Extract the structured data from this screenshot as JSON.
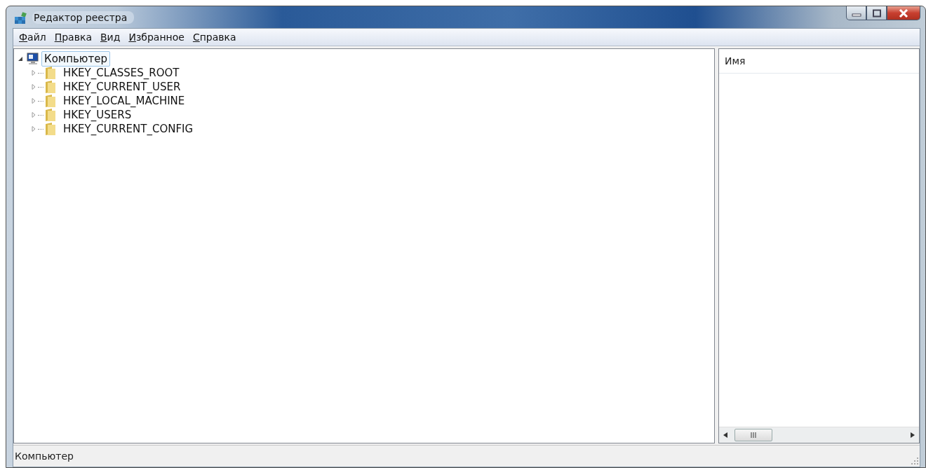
{
  "window": {
    "title": "Редактор реестра"
  },
  "menu": [
    "Файл",
    "Правка",
    "Вид",
    "Избранное",
    "Справка"
  ],
  "tree": {
    "label": "Компьютер",
    "expanded": true,
    "selected": true,
    "children": [
      {
        "label": "HKEY_CLASSES_ROOT",
        "expanded": false,
        "selected": false
      },
      {
        "label": "HKEY_CURRENT_USER",
        "expanded": false,
        "selected": false
      },
      {
        "label": "HKEY_LOCAL_MACHINE",
        "expanded": false,
        "selected": false
      },
      {
        "label": "HKEY_USERS",
        "expanded": false,
        "selected": false
      },
      {
        "label": "HKEY_CURRENT_CONFIG",
        "expanded": false,
        "selected": false
      }
    ]
  },
  "list_view": {
    "columns": [
      "Имя"
    ]
  },
  "status_bar": "Компьютер"
}
